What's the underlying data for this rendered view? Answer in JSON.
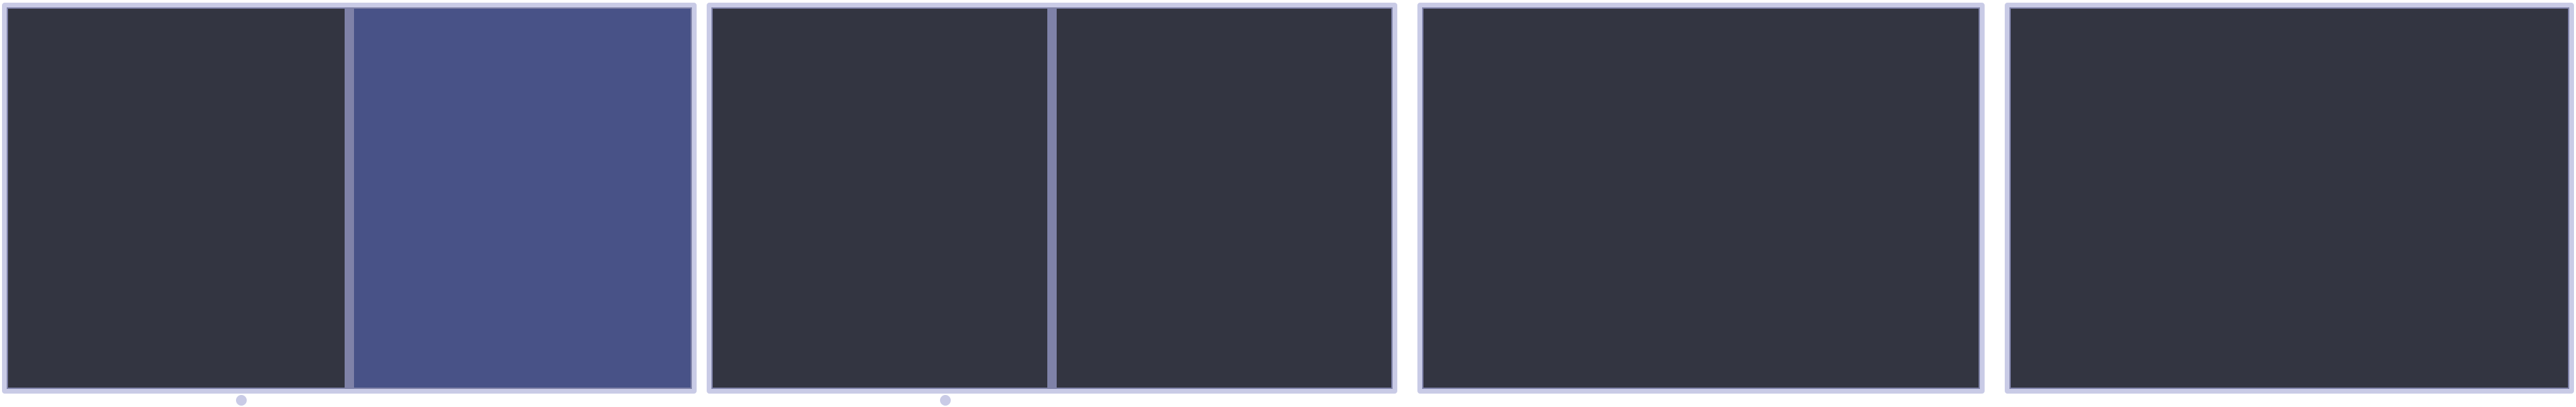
{
  "colors": {
    "outer_border": "#c9cbe6",
    "inner_border": "#7f82a8",
    "pane_background": "#333541",
    "pane_active": "#485287",
    "indicator_dot": "#c9cbe6",
    "page_background": "#ffffff"
  },
  "workspaces": [
    {
      "id": "workspace-1",
      "panes": [
        {
          "id": "pane-1-1",
          "focused": false
        },
        {
          "id": "pane-1-2",
          "focused": true
        }
      ],
      "has_indicator": true
    },
    {
      "id": "workspace-2",
      "panes": [
        {
          "id": "pane-2-1",
          "focused": false
        },
        {
          "id": "pane-2-2",
          "focused": false
        }
      ],
      "has_indicator": true
    },
    {
      "id": "workspace-3",
      "panes": [
        {
          "id": "pane-3-1",
          "focused": false
        }
      ],
      "has_indicator": false
    },
    {
      "id": "workspace-4",
      "panes": [
        {
          "id": "pane-4-1",
          "focused": false
        }
      ],
      "has_indicator": false
    }
  ]
}
